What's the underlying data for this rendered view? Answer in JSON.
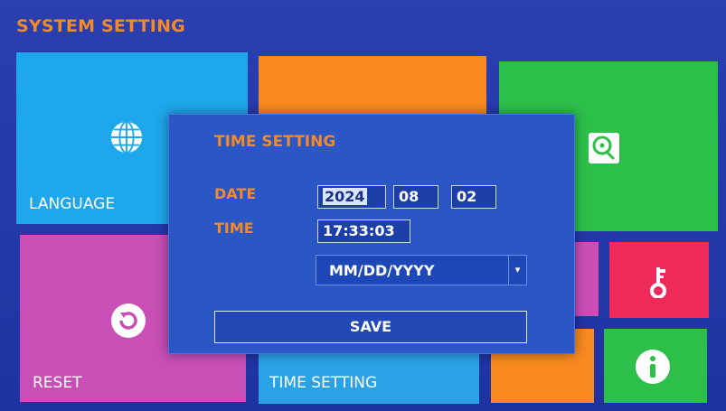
{
  "screen": {
    "title": "SYSTEM SETTING"
  },
  "tiles": {
    "language": {
      "label": "LANGUAGE",
      "icon": "globe-icon",
      "color": "#1ea7ea"
    },
    "reset": {
      "label": "RESET",
      "icon": "reset-icon",
      "color": "#c74fb5"
    },
    "time_setting": {
      "label": "TIME SETTING",
      "color": "#2aa3e6"
    },
    "storage": {
      "icon": "hard-drive-icon",
      "color": "#2cc04a"
    },
    "password": {
      "icon": "key-icon",
      "color": "#ee2a5a"
    },
    "info": {
      "icon": "info-icon",
      "color": "#2cc04a"
    },
    "accent_orange": "#f88a1f"
  },
  "dialog": {
    "title": "TIME SETTING",
    "date_label": "DATE",
    "time_label": "TIME",
    "year": "2024",
    "month": "08",
    "day": "02",
    "time": "17:33:03",
    "date_format": "MM/DD/YYYY",
    "save_label": "SAVE"
  },
  "colors": {
    "background": "#2438a8",
    "dialog": "#2a56c6",
    "heading": "#f08a2a"
  }
}
